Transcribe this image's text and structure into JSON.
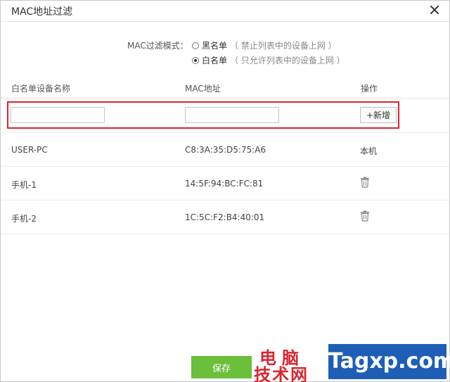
{
  "dialog": {
    "title": "MAC地址过滤"
  },
  "mode": {
    "label": "MAC过滤模式：",
    "options": [
      {
        "label": "黑名单",
        "hint": "（ 禁止列表中的设备上网 ）",
        "checked": false
      },
      {
        "label": "白名单",
        "hint": "（ 只允许列表中的设备上网 ）",
        "checked": true
      }
    ]
  },
  "table": {
    "headers": {
      "name": "白名单设备名称",
      "mac": "MAC地址",
      "action": "操作"
    },
    "add_row": {
      "name_value": "",
      "mac_value": "",
      "add_label": "+新增"
    },
    "rows": [
      {
        "name": "USER-PC",
        "mac": "C8:3A:35:D5:75:A6",
        "action": "本机",
        "action_icon": ""
      },
      {
        "name": "手机-1",
        "mac": "14:5F:94:BC:FC:81",
        "action": "",
        "action_icon": "trash-icon"
      },
      {
        "name": "手机-2",
        "mac": "1C:5C:F2:B4:40:01",
        "action": "",
        "action_icon": "trash-icon"
      }
    ]
  },
  "footer": {
    "save_label": "保存"
  },
  "watermark": {
    "line1": "电脑",
    "line2": "技术网",
    "brand": "Tagxp.com"
  },
  "colors": {
    "accent_green": "#6bbf3b",
    "highlight_red": "#d9232b",
    "watermark_red": "#d8262f",
    "watermark_blue": "#1e5fb5"
  }
}
